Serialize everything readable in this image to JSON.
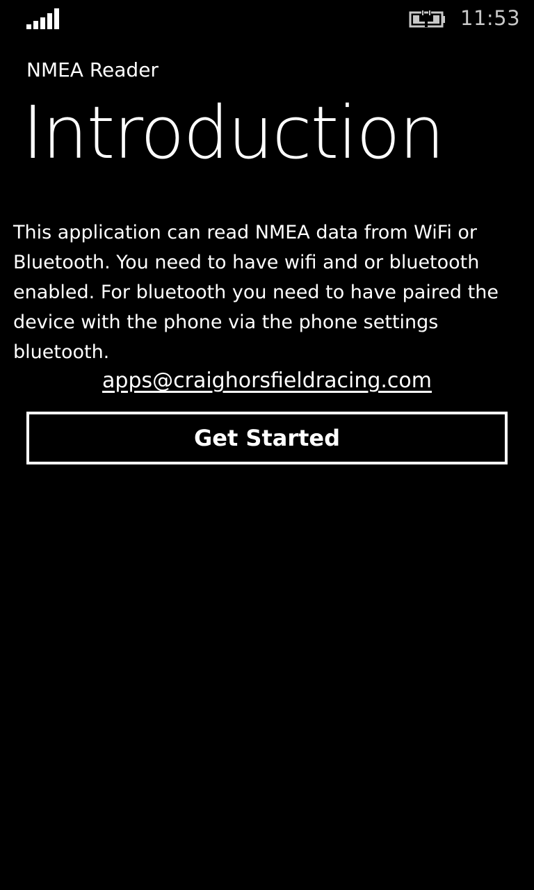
{
  "status_bar": {
    "signal_icon": "signal-strength-icon",
    "battery_icon": "battery-charging-icon",
    "time": "11:53"
  },
  "header": {
    "app_name": "NMEA Reader",
    "page_title": "Introduction"
  },
  "content": {
    "description": "This application can read NMEA data from WiFi or Bluetooth. You need to have wifi and or bluetooth enabled. For bluetooth you need to have paired the device with the phone via the phone settings bluetooth.",
    "email": "apps@craighorsfieldracing.com"
  },
  "actions": {
    "get_started_label": "Get Started"
  },
  "colors": {
    "background": "#000000",
    "foreground": "#ffffff",
    "status_text": "#c8c8c8"
  }
}
